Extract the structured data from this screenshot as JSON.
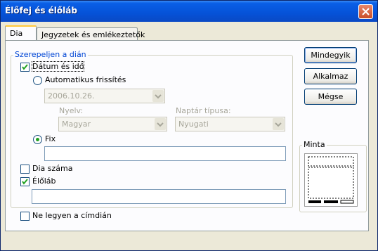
{
  "window": {
    "title": "Élőfej és élőláb"
  },
  "tabs": [
    {
      "label": "Dia",
      "active": true
    },
    {
      "label": "Jegyzetek és emlékeztetők",
      "active": false
    }
  ],
  "group_on_slide": {
    "legend": "Szerepeljen a dián",
    "date_time": {
      "label": "Dátum és idő",
      "checked": true
    },
    "auto_update": {
      "label": "Automatikus frissítés",
      "selected": false
    },
    "date_combo": {
      "value": "2006.10.26."
    },
    "language": {
      "label": "Nyelv:",
      "value": "Magyar"
    },
    "calendar": {
      "label": "Naptár típusa:",
      "value": "Nyugati"
    },
    "fixed": {
      "label": "Fix",
      "selected": true,
      "value": ""
    },
    "slide_number": {
      "label": "Dia száma",
      "checked": false
    },
    "footer": {
      "label": "Élőláb",
      "checked": true,
      "value": ""
    }
  },
  "dont_show_title": {
    "label": "Ne legyen a címdián",
    "checked": false
  },
  "buttons": {
    "apply_all": "Mindegyik",
    "apply": "Alkalmaz",
    "cancel": "Mégse"
  },
  "preview": {
    "legend": "Minta"
  },
  "colors": {
    "title_bar": "#0552d8",
    "legend_text": "#0046d5",
    "check_mark": "#21a121"
  }
}
